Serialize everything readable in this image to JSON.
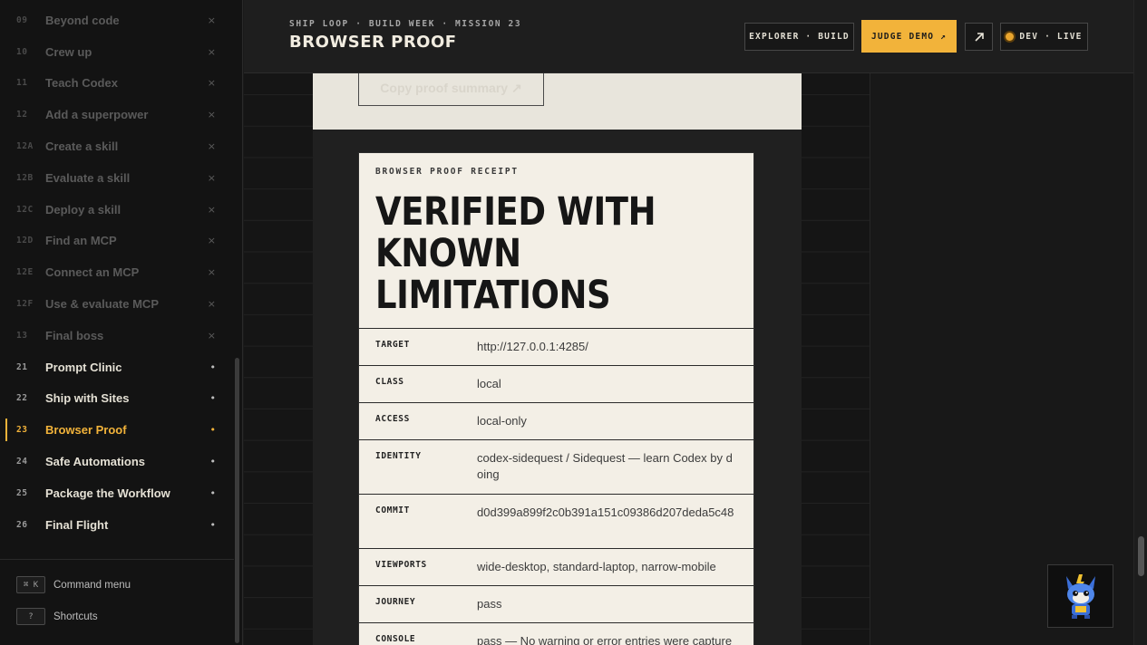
{
  "sidebar": {
    "items": [
      {
        "num": "09",
        "label": "Beyond code",
        "mark": "×",
        "state": "locked"
      },
      {
        "num": "10",
        "label": "Crew up",
        "mark": "×",
        "state": "locked"
      },
      {
        "num": "11",
        "label": "Teach Codex",
        "mark": "×",
        "state": "locked"
      },
      {
        "num": "12",
        "label": "Add a superpower",
        "mark": "×",
        "state": "locked"
      },
      {
        "num": "12A",
        "label": "Create a skill",
        "mark": "×",
        "state": "locked"
      },
      {
        "num": "12B",
        "label": "Evaluate a skill",
        "mark": "×",
        "state": "locked"
      },
      {
        "num": "12C",
        "label": "Deploy a skill",
        "mark": "×",
        "state": "locked"
      },
      {
        "num": "12D",
        "label": "Find an MCP",
        "mark": "×",
        "state": "locked"
      },
      {
        "num": "12E",
        "label": "Connect an MCP",
        "mark": "×",
        "state": "locked"
      },
      {
        "num": "12F",
        "label": "Use & evaluate MCP",
        "mark": "×",
        "state": "locked"
      },
      {
        "num": "13",
        "label": "Final boss",
        "mark": "×",
        "state": "locked"
      },
      {
        "num": "21",
        "label": "Prompt Clinic",
        "mark": "•",
        "state": "open"
      },
      {
        "num": "22",
        "label": "Ship with Sites",
        "mark": "•",
        "state": "open"
      },
      {
        "num": "23",
        "label": "Browser Proof",
        "mark": "•",
        "state": "active"
      },
      {
        "num": "24",
        "label": "Safe Automations",
        "mark": "•",
        "state": "open"
      },
      {
        "num": "25",
        "label": "Package the Workflow",
        "mark": "•",
        "state": "open"
      },
      {
        "num": "26",
        "label": "Final Flight",
        "mark": "•",
        "state": "open"
      }
    ],
    "shortcuts": [
      {
        "key": "⌘ K",
        "label": "Command menu"
      },
      {
        "key": "?",
        "label": "Shortcuts"
      }
    ]
  },
  "header": {
    "eyebrow": "SHIP LOOP · BUILD WEEK · MISSION 23",
    "title": "BROWSER PROOF",
    "mode_button": "EXPLORER · BUILD",
    "judge_button": "JUDGE DEMO ↗",
    "external_icon": "arrow-up-right-icon",
    "status": "DEV · LIVE"
  },
  "copy_button": "Copy proof summary ↗",
  "receipt": {
    "eyebrow": "BROWSER PROOF RECEIPT",
    "title": "VERIFIED WITH KNOWN LIMITATIONS",
    "rows": [
      {
        "key": "TARGET",
        "value": "http://127.0.0.1:4285/"
      },
      {
        "key": "CLASS",
        "value": "local"
      },
      {
        "key": "ACCESS",
        "value": "local-only"
      },
      {
        "key": "IDENTITY",
        "value": "codex-sidequest / Sidequest — learn Codex by doing"
      },
      {
        "key": "COMMIT",
        "value": "d0d399a899f2c0b391a151c09386d207deda5c48"
      },
      {
        "key": "VIEWPORTS",
        "value": "wide-desktop, standard-laptop, narrow-mobile"
      },
      {
        "key": "JOURNEY",
        "value": "pass"
      },
      {
        "key": "CONSOLE",
        "value": "pass — No warning or error entries were captured"
      }
    ]
  },
  "colors": {
    "accent": "#f2b33a",
    "paper": "#f3efe6",
    "ink": "#161616"
  }
}
